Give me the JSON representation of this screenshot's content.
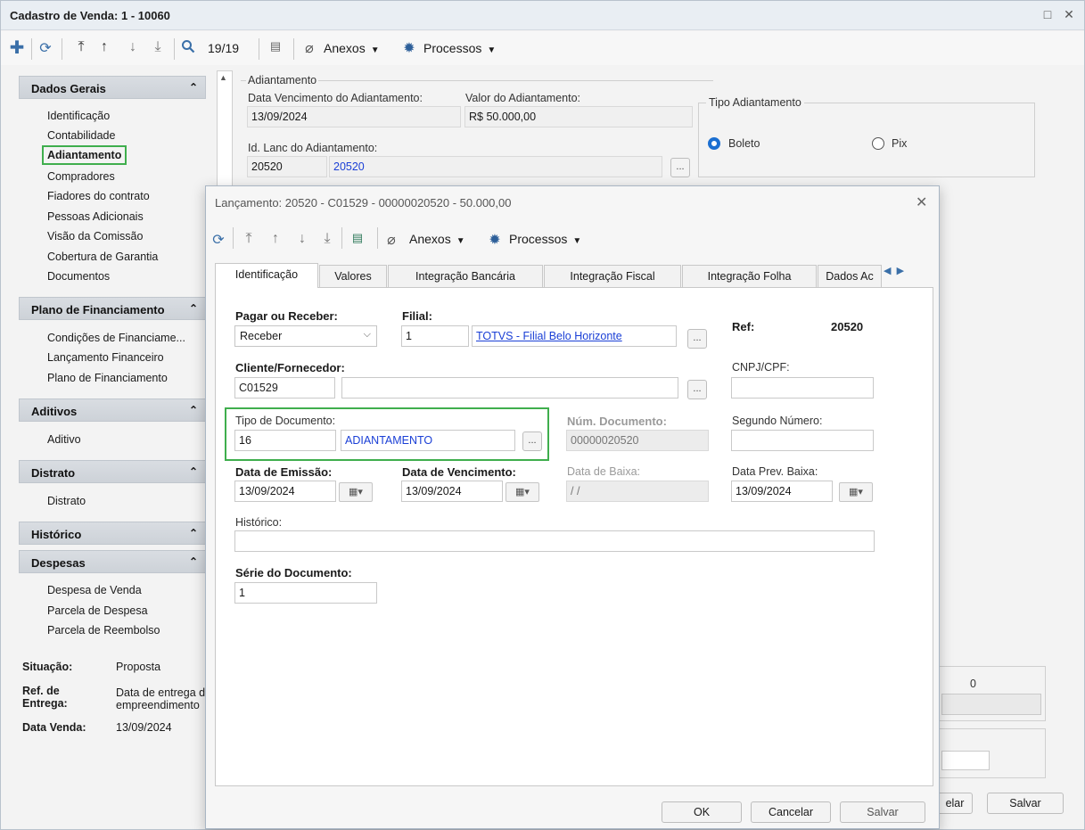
{
  "window": {
    "title": "Cadastro de Venda: 1 - 10060",
    "restore": "□",
    "close": "✕"
  },
  "toolbar": {
    "record_counter": "19/19",
    "attachments": "Anexos",
    "processes": "Processos"
  },
  "sidebar": {
    "dados_gerais": {
      "title": "Dados Gerais",
      "items": [
        "Identificação",
        "Contabilidade",
        "Adiantamento",
        "Compradores",
        "Fiadores do contrato",
        "Pessoas Adicionais",
        "Visão da Comissão",
        "Cobertura de Garantia",
        "Documentos"
      ]
    },
    "plano": {
      "title": "Plano de Financiamento",
      "items": [
        "Condições de Financiame...",
        "Lançamento Financeiro",
        "Plano de Financiamento"
      ]
    },
    "aditivos": {
      "title": "Aditivos",
      "items": [
        "Aditivo"
      ]
    },
    "distrato": {
      "title": "Distrato",
      "items": [
        "Distrato"
      ]
    },
    "historico": {
      "title": "Histórico"
    },
    "despesas": {
      "title": "Despesas",
      "items": [
        "Despesa de Venda",
        "Parcela de Despesa",
        "Parcela de Reembolso"
      ]
    },
    "collapse_glyph": "⌃"
  },
  "info": {
    "situacao_label": "Situação:",
    "situacao_value": "Proposta",
    "ref_label_1": "Ref. de",
    "ref_label_2": "Entrega:",
    "ref_value_1": "Data de entrega d",
    "ref_value_2": "empreendimento",
    "data_venda_label": "Data Venda:",
    "data_venda_value": "13/09/2024"
  },
  "adiantamento": {
    "group_label": "Adiantamento",
    "data_venc_label": "Data Vencimento do Adiantamento:",
    "data_venc_value": "13/09/2024",
    "valor_label": "Valor do Adiantamento:",
    "valor_value": "R$ 50.000,00",
    "id_lanc_label": "Id. Lanc do Adiantamento:",
    "id_lanc_value": "20520",
    "id_lanc_desc": "20520",
    "tipo_label": "Tipo Adiantamento",
    "opt_boleto": "Boleto",
    "opt_pix": "Pix"
  },
  "background_right": {
    "count_value": "0",
    "cancel_partial": "elar",
    "save": "Salvar"
  },
  "modal": {
    "title": "Lançamento: 20520 - C01529 - 00000020520 - 50.000,00",
    "attachments": "Anexos",
    "processes": "Processos",
    "tabs": [
      "Identificação",
      "Valores",
      "Integração Bancária",
      "Integração Fiscal",
      "Integração Folha",
      "Dados Ac"
    ],
    "pagar_label": "Pagar ou Receber:",
    "pagar_value": "Receber",
    "filial_label": "Filial:",
    "filial_code": "1",
    "filial_name": "TOTVS - Filial Belo Horizonte",
    "ref_label": "Ref:",
    "ref_value": "20520",
    "cliente_label": "Cliente/Fornecedor:",
    "cliente_code": "C01529",
    "cnpj_label": "CNPJ/CPF:",
    "tipo_doc_label": "Tipo de Documento:",
    "tipo_doc_code": "16",
    "tipo_doc_desc": "ADIANTAMENTO",
    "num_doc_label": "Núm. Documento:",
    "num_doc_value": "00000020520",
    "segundo_label": "Segundo Número:",
    "emissao_label": "Data de Emissão:",
    "emissao_value": "13/09/2024",
    "venc_label": "Data de Vencimento:",
    "venc_value": "13/09/2024",
    "baixa_label": "Data de Baixa:",
    "baixa_value": "/ /",
    "prev_baixa_label": "Data Prev. Baixa:",
    "prev_baixa_value": "13/09/2024",
    "historico_label": "Histórico:",
    "serie_label": "Série do Documento:",
    "serie_value": "1",
    "ok": "OK",
    "cancel": "Cancelar",
    "save": "Salvar",
    "ellipsis": "..."
  }
}
